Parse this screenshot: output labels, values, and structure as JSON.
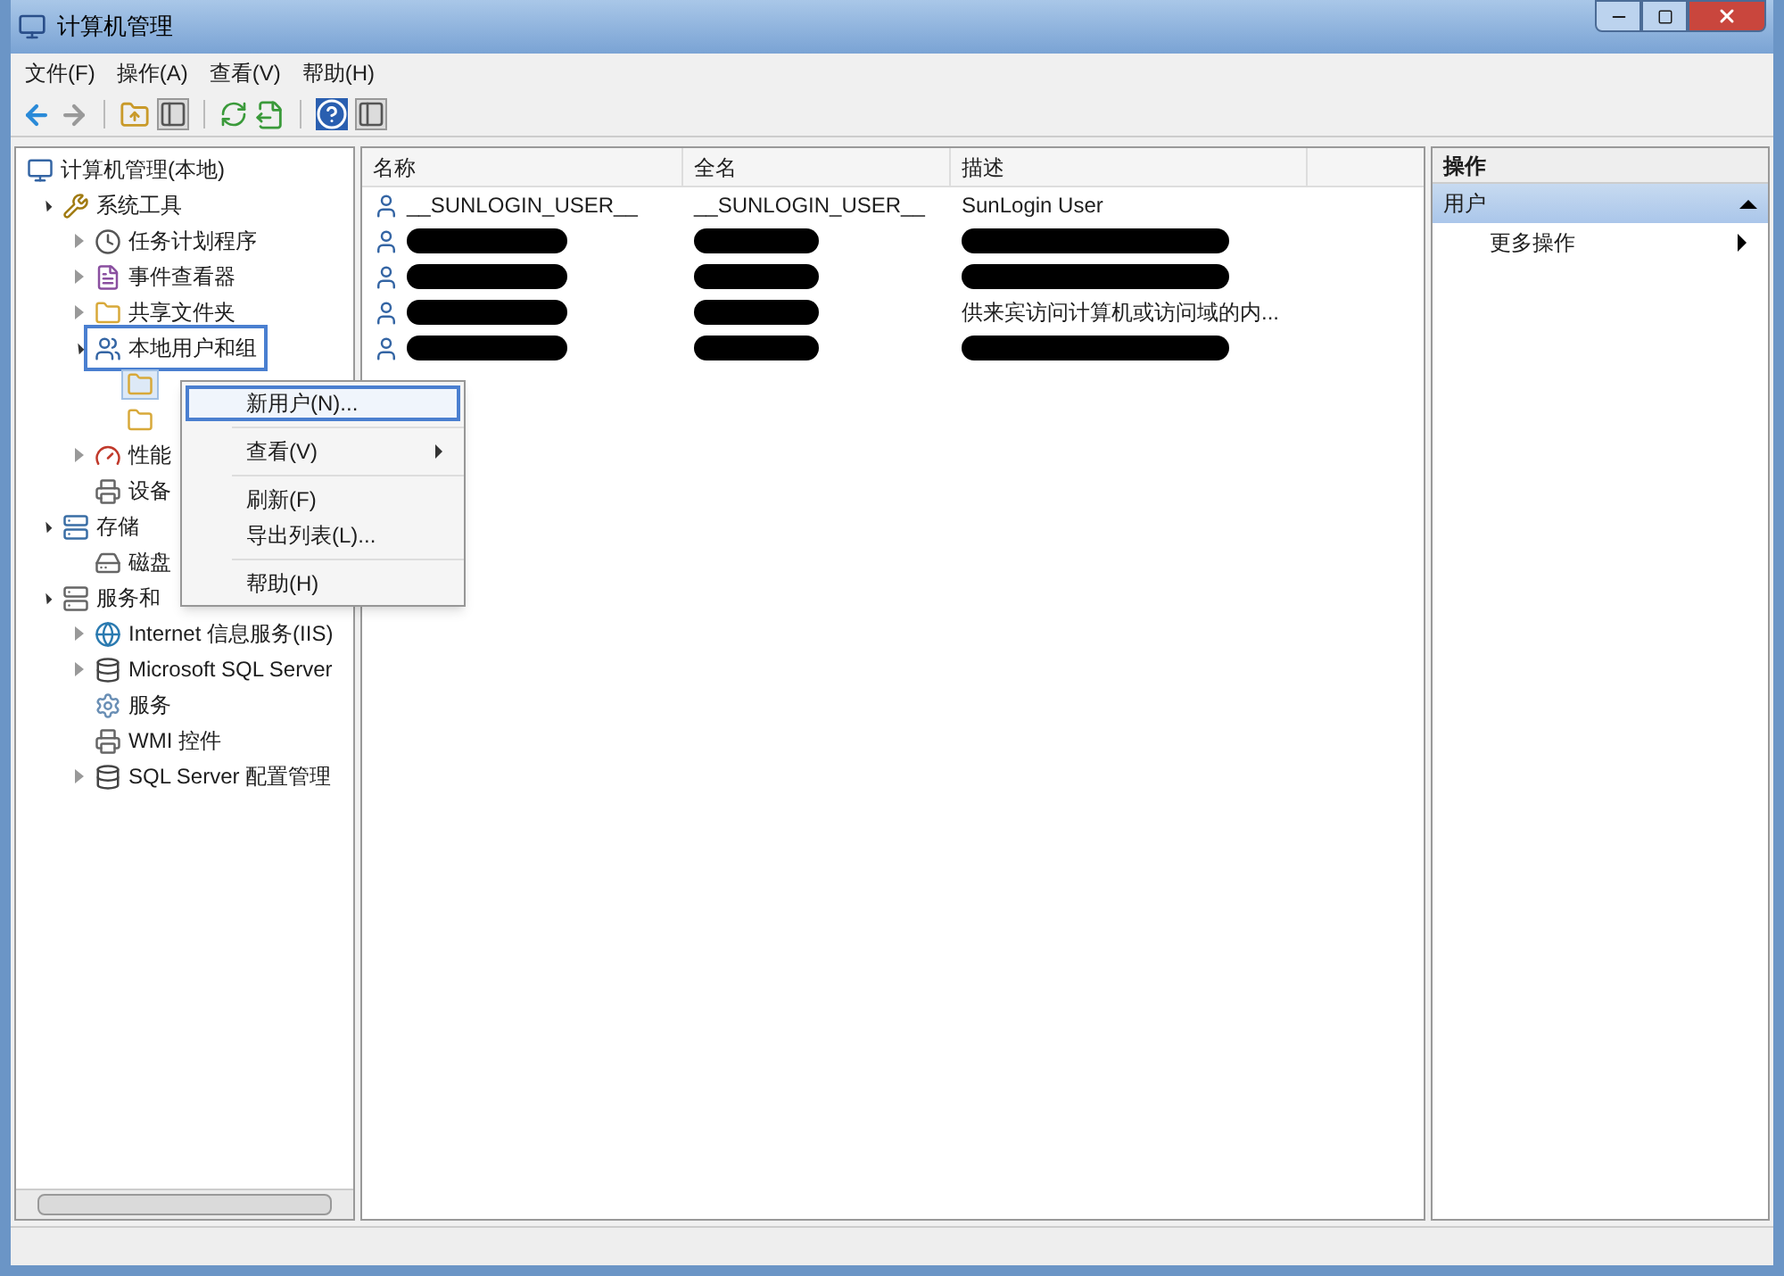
{
  "window": {
    "title": "计算机管理"
  },
  "menu_bar": [
    "文件(F)",
    "操作(A)",
    "查看(V)",
    "帮助(H)"
  ],
  "tree": [
    {
      "label": "计算机管理(本地)",
      "kind": "computer",
      "selected": false,
      "children": [
        {
          "label": "系统工具",
          "kind": "tools",
          "expanded": true,
          "selected": false,
          "children": [
            {
              "label": "任务计划程序",
              "kind": "clock",
              "expanded": false,
              "selected": false
            },
            {
              "label": "事件查看器",
              "kind": "log",
              "expanded": false,
              "selected": false
            },
            {
              "label": "共享文件夹",
              "kind": "folder",
              "expanded": false,
              "selected": false
            },
            {
              "label": "本地用户和组",
              "kind": "users",
              "expanded": true,
              "selected": false,
              "annotated": true,
              "children": [
                {
                  "kind": "folder",
                  "selected": true
                },
                {
                  "kind": "folder",
                  "selected": false
                }
              ]
            },
            {
              "label": "性能",
              "kind": "gauge",
              "expanded": false,
              "selected": false
            },
            {
              "label": "设备",
              "kind": "device",
              "selected": false
            }
          ]
        },
        {
          "label": "存储",
          "kind": "storage",
          "expanded": true,
          "selected": false,
          "children": [
            {
              "label": "磁盘",
              "kind": "disk",
              "selected": false
            }
          ]
        },
        {
          "label": "服务和",
          "kind": "services",
          "expanded": true,
          "selected": false,
          "children": [
            {
              "label": "Internet 信息服务(IIS)",
              "kind": "globe",
              "expanded": false,
              "selected": false
            },
            {
              "label": "Microsoft SQL Server",
              "kind": "database",
              "expanded": false,
              "selected": false
            },
            {
              "label": "服务",
              "kind": "gear",
              "selected": false
            },
            {
              "label": "WMI 控件",
              "kind": "device",
              "selected": false
            },
            {
              "label": "SQL Server 配置管理",
              "kind": "database",
              "expanded": false,
              "selected": false
            }
          ]
        }
      ]
    }
  ],
  "table": {
    "columns": [
      "名称",
      "全名",
      "描述"
    ],
    "rows": [
      {
        "name": "__SUNLOGIN_USER__",
        "full_name": "__SUNLOGIN_USER__",
        "description": "SunLogin User",
        "redacted": false
      },
      {
        "redacted": true
      },
      {
        "redacted": true
      },
      {
        "description": "供来宾访问计算机或访问域的内...",
        "redacted": true
      },
      {
        "redacted": true
      }
    ]
  },
  "context_menu": [
    {
      "kind": "item",
      "label": "新用户(N)...",
      "annotated": true,
      "has_submenu": false
    },
    {
      "kind": "separator"
    },
    {
      "kind": "item",
      "label": "查看(V)",
      "annotated": false,
      "has_submenu": true
    },
    {
      "kind": "separator"
    },
    {
      "kind": "item",
      "label": "刷新(F)",
      "annotated": false,
      "has_submenu": false
    },
    {
      "kind": "item",
      "label": "导出列表(L)...",
      "annotated": false,
      "has_submenu": false
    },
    {
      "kind": "separator"
    },
    {
      "kind": "item",
      "label": "帮助(H)",
      "annotated": false,
      "has_submenu": false
    }
  ],
  "actions_pane": {
    "title": "操作",
    "section": {
      "label": "用户",
      "expanded": true
    },
    "items": [
      {
        "label": "更多操作",
        "has_submenu": true
      }
    ]
  }
}
